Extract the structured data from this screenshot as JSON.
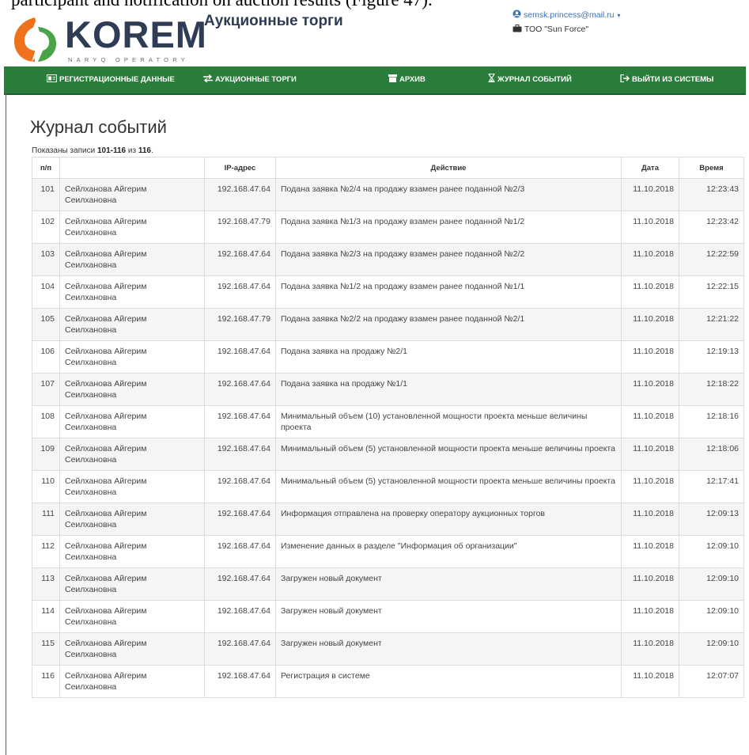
{
  "caption": "participant and notification on auction results (Figure 47).",
  "brand": {
    "name": "KOREM",
    "subtitle": "NARYQ OPERATORY",
    "colors": {
      "orange": "#f0711d",
      "green": "#4aa447",
      "navy": "#2f3c56"
    }
  },
  "app_title": "Аукционные торги",
  "user": {
    "email": "semsk.princess@mail.ru",
    "email_icon": "user-circle-icon",
    "org": "ТОО \"Sun Force\"",
    "org_icon": "briefcase-icon"
  },
  "nav": [
    {
      "label": "РЕГИСТРАЦИОННЫЕ ДАННЫЕ",
      "icon": "id-card-icon"
    },
    {
      "label": "АУКЦИОННЫЕ ТОРГИ",
      "icon": "exchange-icon"
    },
    {
      "label": "АРХИВ",
      "icon": "archive-icon"
    },
    {
      "label": "ЖУРНАЛ СОБЫТИЙ",
      "icon": "hourglass-icon"
    },
    {
      "label": "ВЫЙТИ ИЗ СИСТЕМЫ",
      "icon": "sign-out-icon"
    }
  ],
  "colors": {
    "nav_bg": "#2a7d3a",
    "row_alt": "#f5f5f5"
  },
  "page_title": "Журнал событий",
  "summary": {
    "prefix": "Показаны записи ",
    "range": "101-116",
    "middle": " из ",
    "total": "116",
    "suffix": "."
  },
  "table": {
    "headers": [
      "п/п",
      "",
      "IP-адрес",
      "Действие",
      "Дата",
      "Время"
    ],
    "rows": [
      {
        "num": "101",
        "user": "Сейлханова Айгерим Сеилхановна",
        "ip": "192.168.47.64",
        "action": "Подана заявка №2/4 на продажу взамен ранее поданной №2/3",
        "date": "11.10.2018",
        "time": "12:23:43"
      },
      {
        "num": "102",
        "user": "Сейлханова Айгерим Сеилхановна",
        "ip": "192.168.47.79",
        "action": "Подана заявка №1/3 на продажу взамен ранее поданной №1/2",
        "date": "11.10.2018",
        "time": "12:23:42"
      },
      {
        "num": "103",
        "user": "Сейлханова Айгерим Сеилхановна",
        "ip": "192.168.47.64",
        "action": "Подана заявка №2/3 на продажу взамен ранее поданной №2/2",
        "date": "11.10.2018",
        "time": "12:22:59"
      },
      {
        "num": "104",
        "user": "Сейлханова Айгерим Сеилхановна",
        "ip": "192.168.47.64",
        "action": "Подана заявка №1/2 на продажу взамен ранее поданной №1/1",
        "date": "11.10.2018",
        "time": "12:22:15"
      },
      {
        "num": "105",
        "user": "Сейлханова Айгерим Сеилхановна",
        "ip": "192.168.47.79",
        "action": "Подана заявка №2/2 на продажу взамен ранее поданной №2/1",
        "date": "11.10.2018",
        "time": "12:21:22"
      },
      {
        "num": "106",
        "user": "Сейлханова Айгерим Сеилхановна",
        "ip": "192.168.47.64",
        "action": "Подана заявка на продажу №2/1",
        "date": "11.10.2018",
        "time": "12:19:13"
      },
      {
        "num": "107",
        "user": "Сейлханова Айгерим Сеилхановна",
        "ip": "192.168.47.64",
        "action": "Подана заявка на продажу №1/1",
        "date": "11.10.2018",
        "time": "12:18:22"
      },
      {
        "num": "108",
        "user": "Сейлханова Айгерим Сеилхановна",
        "ip": "192.168.47.64",
        "action": "Минимальный объем (10) установленной мощности проекта меньше величины проекта",
        "date": "11.10.2018",
        "time": "12:18:16"
      },
      {
        "num": "109",
        "user": "Сейлханова Айгерим Сеилхановна",
        "ip": "192.168.47.64",
        "action": "Минимальный объем (5) установленной мощности проекта меньше величины проекта",
        "date": "11.10.2018",
        "time": "12:18:06"
      },
      {
        "num": "110",
        "user": "Сейлханова Айгерим Сеилхановна",
        "ip": "192.168.47.64",
        "action": "Минимальный объем (5) установленной мощности проекта меньше величины проекта",
        "date": "11.10.2018",
        "time": "12:17:41"
      },
      {
        "num": "111",
        "user": "Сейлханова Айгерим Сеилхановна",
        "ip": "192.168.47.64",
        "action": "Информация отправлена на проверку оператору аукционных торгов",
        "date": "11.10.2018",
        "time": "12:09:13"
      },
      {
        "num": "112",
        "user": "Сейлханова Айгерим Сеилхановна",
        "ip": "192.168.47.64",
        "action": "Изменение данных в разделе \"Информация об организации\"",
        "date": "11.10.2018",
        "time": "12:09:10"
      },
      {
        "num": "113",
        "user": "Сейлханова Айгерим Сеилхановна",
        "ip": "192.168.47.64",
        "action": "Загружен новый документ",
        "date": "11.10.2018",
        "time": "12:09:10"
      },
      {
        "num": "114",
        "user": "Сейлханова Айгерим Сеилхановна",
        "ip": "192.168.47.64",
        "action": "Загружен новый документ",
        "date": "11.10.2018",
        "time": "12:09:10"
      },
      {
        "num": "115",
        "user": "Сейлханова Айгерим Сеилхановна",
        "ip": "192.168.47.64",
        "action": "Загружен новый документ",
        "date": "11.10.2018",
        "time": "12:09:10"
      },
      {
        "num": "116",
        "user": "Сейлханова Айгерим Сеилхановна",
        "ip": "192.168.47.64",
        "action": "Регистрация в системе",
        "date": "11.10.2018",
        "time": "12:07:07"
      }
    ]
  }
}
